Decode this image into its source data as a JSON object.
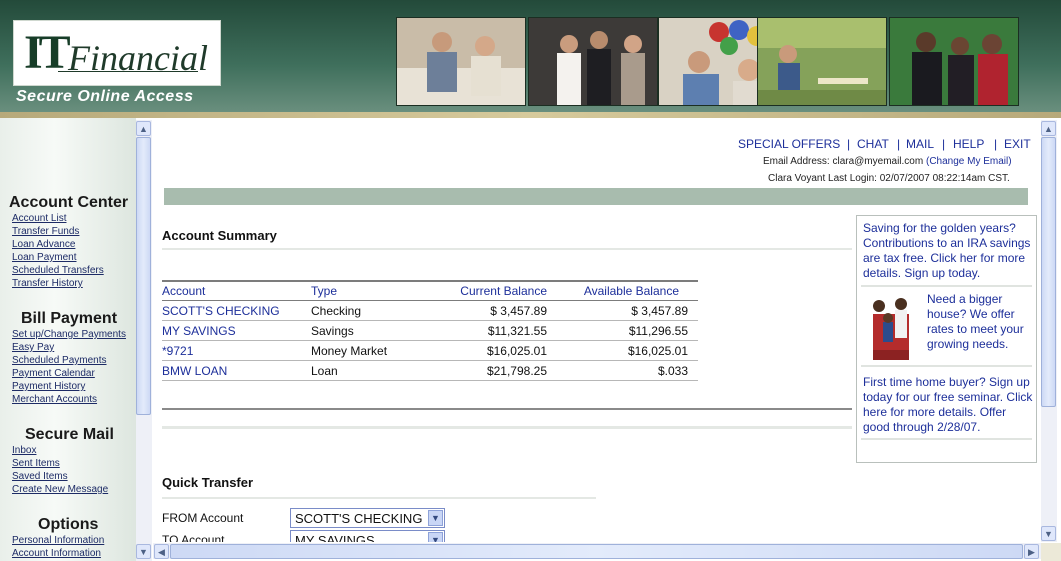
{
  "header": {
    "logo_it": "IT",
    "logo_financial": "Financial",
    "tagline": "Secure Online Access"
  },
  "nav": {
    "sections": [
      {
        "title": "Account Center",
        "links": [
          "Account List",
          "Transfer Funds",
          "Loan Advance",
          "Loan Payment",
          "Scheduled Transfers",
          "Transfer History"
        ]
      },
      {
        "title": "Bill Payment",
        "links": [
          "Set up/Change Payments",
          "Easy Pay",
          "Scheduled Payments",
          "Payment Calendar",
          "Payment History",
          "Merchant Accounts"
        ]
      },
      {
        "title": "Secure Mail",
        "links": [
          "Inbox",
          "Sent Items",
          "Saved Items",
          "Create New Message"
        ]
      },
      {
        "title": "Options",
        "links": [
          "Personal Information",
          "Account Information"
        ]
      }
    ]
  },
  "toplinks": [
    "SPECIAL OFFERS",
    "CHAT",
    "MAIL",
    "HELP",
    "EXIT"
  ],
  "user": {
    "email_label": "Email Address: clara@myemail.com",
    "change_email": "(Change My Email)",
    "last_login": "Clara Voyant Last Login: 02/07/2007 08:22:14am CST."
  },
  "summary": {
    "title": "Account Summary",
    "columns": [
      "Account",
      "Type",
      "Current Balance",
      "Available Balance"
    ],
    "rows": [
      [
        "SCOTT'S CHECKING",
        "Checking",
        "$ 3,457.89",
        "$ 3,457.89"
      ],
      [
        "MY SAVINGS",
        "Savings",
        "$11,321.55",
        "$11,296.55"
      ],
      [
        "*9721",
        "Money Market",
        "$16,025.01",
        "$16,025.01"
      ],
      [
        "BMW LOAN",
        "Loan",
        "$21,798.25",
        "$.033"
      ]
    ]
  },
  "promos": {
    "p1": "Saving for the golden years? Contributions to an IRA savings are tax free. Click her for more details. Sign up today.",
    "p2": "Need a bigger house? We offer rates to meet your growing needs.",
    "p3": "First time home buyer? Sign up today for our free seminar. Click here for more details. Offer good through 2/28/07."
  },
  "quick_transfer": {
    "title": "Quick Transfer",
    "from_label": "FROM Account",
    "from_value": "SCOTT'S CHECKING",
    "to_label": "TO Account",
    "to_value": "MY SAVINGS"
  },
  "colors": {
    "link": "#1d2f9a",
    "header_green": "#2f5a47",
    "band": "#a8bcae"
  }
}
